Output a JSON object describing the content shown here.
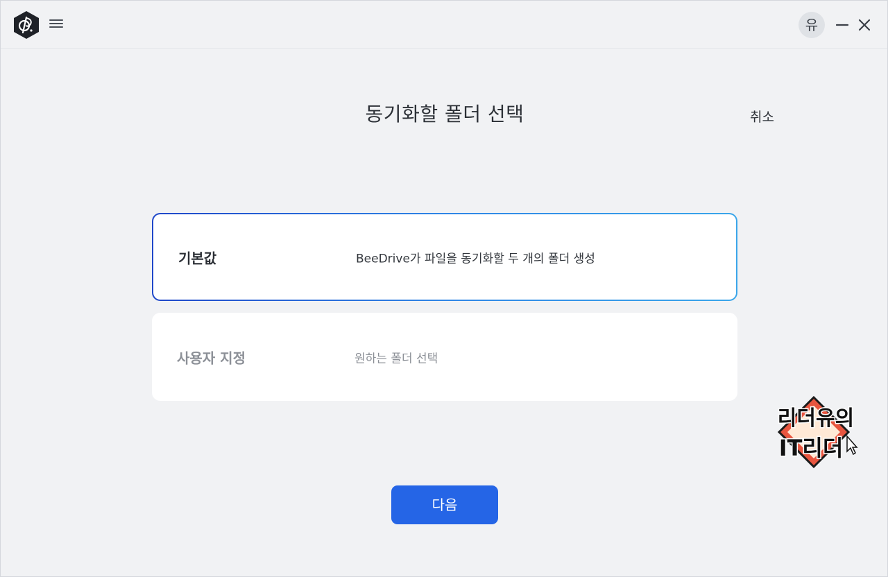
{
  "titlebar": {
    "logo_icon": "beedrive-logo-icon",
    "menu_icon": "hamburger-menu-icon",
    "avatar_text": "유",
    "minimize_icon": "minimize-icon",
    "close_icon": "close-icon"
  },
  "main": {
    "title": "동기화할 폴더 선택",
    "cancel_label": "취소",
    "options": [
      {
        "label": "기본값",
        "description": "BeeDrive가 파일을 동기화할 두 개의 폴더 생성",
        "selected": true
      },
      {
        "label": "사용자 지정",
        "description": "원하는 폴더 선택",
        "selected": false
      }
    ],
    "next_label": "다음"
  },
  "watermark": {
    "line1": "리더유의",
    "line2": "IT리더"
  },
  "colors": {
    "background": "#f1f2f4",
    "accent": "#2565e6",
    "selected_border": "#2f86e6"
  }
}
